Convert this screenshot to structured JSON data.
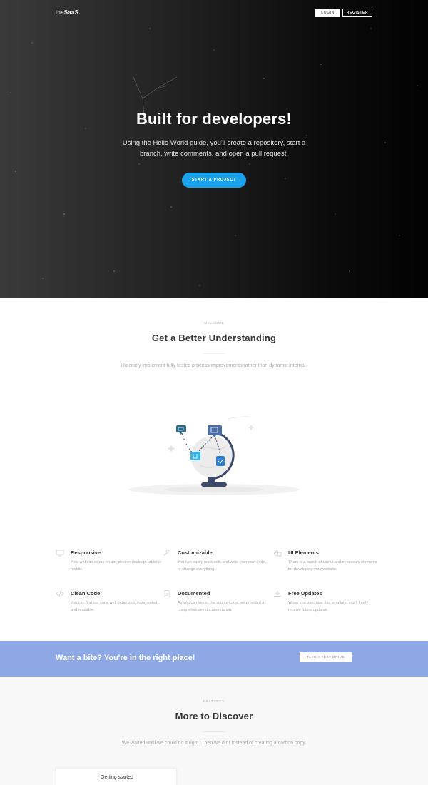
{
  "nav": {
    "logo_prefix": "the",
    "logo_suffix": "SaaS.",
    "login_label": "LOGIN",
    "register_label": "REGISTER"
  },
  "hero": {
    "title": "Built for developers!",
    "subtitle": "Using the Hello World guide, you'll create a repository, start a branch, write comments, and open a pull request.",
    "cta_label": "START A PROJECT"
  },
  "welcome": {
    "eyebrow": "WELCOME",
    "title": "Get a Better Understanding",
    "subtitle": "Holisticly implement fully tested process improvements rather than dynamic internal."
  },
  "features": [
    {
      "icon": "monitor-icon",
      "title": "Responsive",
      "text": "Your website works on any device: desktop, tablet or mobile."
    },
    {
      "icon": "wrench-icon",
      "title": "Customizable",
      "text": "You can easily read, edit, and write your own code, or change everything."
    },
    {
      "icon": "shapes-icon",
      "title": "UI Elements",
      "text": "There is a bunch of useful and necessary elements for developing your website."
    },
    {
      "icon": "code-icon",
      "title": "Clean Code",
      "text": "You can find our code well organized, commented and readable."
    },
    {
      "icon": "document-icon",
      "title": "Documented",
      "text": "As you can see in the source code, we provided a comprehensive documentation."
    },
    {
      "icon": "download-icon",
      "title": "Free Updates",
      "text": "When you purchase this template, you'll freely receive future updates."
    }
  ],
  "cta": {
    "text": "Want a bite? You're in the right place!",
    "button_label": "TAKE A TEST DRIVE"
  },
  "discover": {
    "eyebrow": "FEATURES",
    "title": "More to Discover",
    "subtitle": "We waited until we could do it right. Then we did! Instead of creating a carbon copy.",
    "card_label": "Getting started"
  },
  "colors": {
    "accent_blue": "#1aa3ec",
    "cta_band": "#8ea8e6",
    "illustration_navy": "#3b4a6b"
  }
}
